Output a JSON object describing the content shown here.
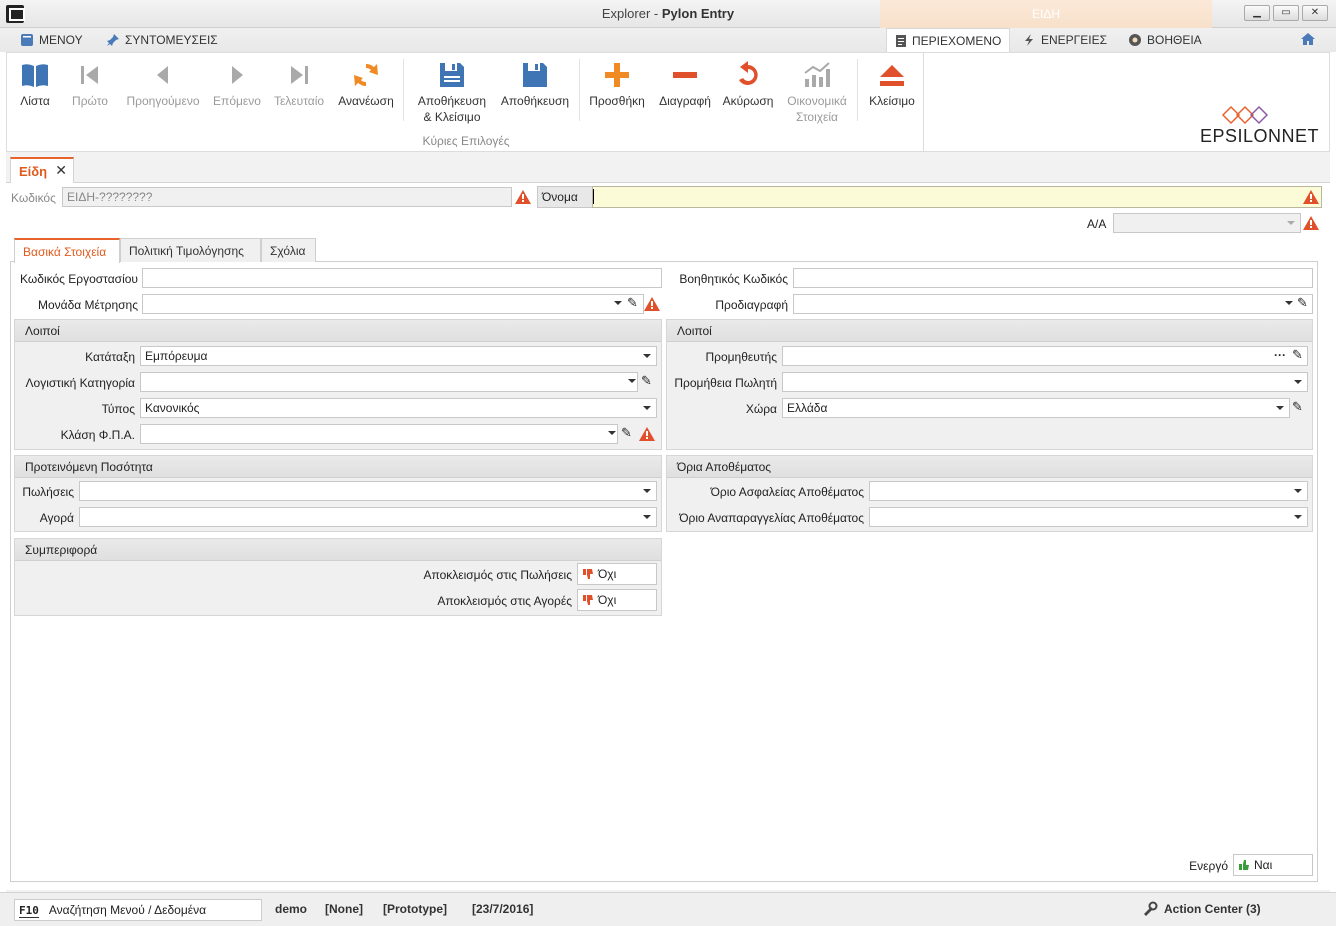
{
  "window": {
    "title_app": "Explorer",
    "title_sep": " - ",
    "title_module": "Pylon Entry",
    "context_label": "ΕΙΔΗ",
    "win_min": "▁",
    "win_max": "▭",
    "win_close": "✕"
  },
  "menu": {
    "menu_label": "ΜΕΝΟΥ",
    "shortcuts_label": "ΣΥΝΤΟΜΕΥΣΕΙΣ",
    "tabs": [
      {
        "label": "ΠΕΡΙΕΧΟΜΕΝΟ"
      },
      {
        "label": "ΕΝΕΡΓΕΙΕΣ"
      },
      {
        "label": "ΒΟΗΘΕΙΑ"
      }
    ]
  },
  "ribbon": {
    "group_label": "Κύριες Επιλογές",
    "buttons": {
      "list": "Λίστα",
      "first": "Πρώτο",
      "previous": "Προηγούμενο",
      "next": "Επόμενο",
      "last": "Τελευταίο",
      "refresh": "Ανανέωση",
      "save_close_1": "Αποθήκευση",
      "save_close_2": "& Κλείσιμο",
      "save": "Αποθήκευση",
      "add": "Προσθήκη",
      "delete": "Διαγραφή",
      "cancel": "Ακύρωση",
      "financial_1": "Οικονομικά",
      "financial_2": "Στοιχεία",
      "close": "Κλείσιμο"
    },
    "logo": "EPSILONNET"
  },
  "colors": {
    "accent": "#e8632b",
    "nav_blue": "#4a7ab8",
    "warning": "#e0502a",
    "disabled": "#a9a9a9"
  },
  "doc": {
    "tab_label": "Είδη",
    "tab_close": "✕",
    "code_label": "Κωδικός",
    "code_value": "ΕΙΔΗ-????????",
    "name_label": "Όνομα",
    "name_value": "",
    "aa_label": "Α/Α",
    "aa_value": ""
  },
  "subtabs": [
    {
      "label": "Βασικά Στοιχεία"
    },
    {
      "label": "Πολιτική Τιμολόγησης"
    },
    {
      "label": "Σχόλια"
    }
  ],
  "basic": {
    "factory_code_label": "Κωδικός Εργοστασίου",
    "factory_code_value": "",
    "aux_code_label": "Βοηθητικός Κωδικός",
    "aux_code_value": "",
    "unit_label": "Μονάδα Μέτρησης",
    "unit_value": "",
    "spec_label": "Προδιαγραφή",
    "spec_value": ""
  },
  "others_left": {
    "title": "Λοιποί",
    "class_label": "Κατάταξη",
    "class_value": "Εμπόρευμα",
    "acc_cat_label": "Λογιστική Κατηγορία",
    "acc_cat_value": "",
    "type_label": "Τύπος",
    "type_value": "Κανονικός",
    "vat_label": "Κλάση Φ.Π.Α.",
    "vat_value": ""
  },
  "others_right": {
    "title": "Λοιποί",
    "supplier_label": "Προμηθευτής",
    "supplier_value": "",
    "commission_label": "Προμήθεια Πωλητή",
    "commission_value": "",
    "country_label": "Χώρα",
    "country_value": "Ελλάδα",
    "ellipsis": "···"
  },
  "suggested_qty": {
    "title": "Προτεινόμενη Ποσότητα",
    "sales_label": "Πωλήσεις",
    "sales_value": "",
    "purchase_label": "Αγορά",
    "purchase_value": ""
  },
  "stock_limits": {
    "title": "Όρια Αποθέματος",
    "safety_label": "Όριο Ασφαλείας Αποθέματος",
    "safety_value": "",
    "reorder_label": "Όριο Αναπαραγγελίας Αποθέματος",
    "reorder_value": ""
  },
  "behavior": {
    "title": "Συμπεριφορά",
    "excl_sales_label": "Αποκλεισμός στις Πωλήσεις",
    "excl_sales_value": "Όχι",
    "excl_purch_label": "Αποκλεισμός στις Αγορές",
    "excl_purch_value": "Όχι"
  },
  "active": {
    "label": "Ενεργό",
    "value": "Ναι"
  },
  "statusbar": {
    "search_key": "F10",
    "search_label": "Αναζήτηση Μενού / Δεδομένα",
    "user": "demo",
    "none": "[None]",
    "prototype": "[Prototype]",
    "date": "[23/7/2016]",
    "action_center": "Action Center (3)"
  }
}
